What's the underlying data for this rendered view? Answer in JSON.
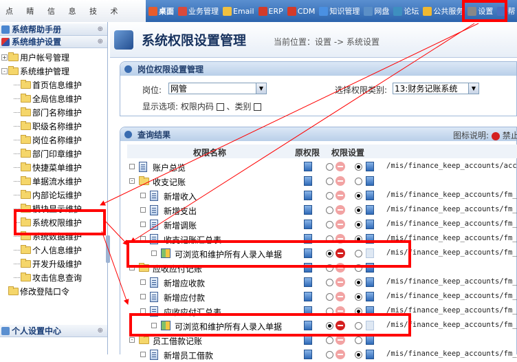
{
  "topbar": {
    "tagline": "点 睛 信 息 技 术",
    "nav": [
      {
        "label": "桌面",
        "icon": "desktop-icon",
        "color": "#e85c2c"
      },
      {
        "label": "业务管理",
        "icon": "users-icon",
        "color": "#d94a3d"
      },
      {
        "label": "Email",
        "icon": "email-icon",
        "color": "#f0c040"
      },
      {
        "label": "ERP",
        "icon": "erp-icon",
        "color": "#d33b2a"
      },
      {
        "label": "CDM",
        "icon": "cdm-icon",
        "color": "#d33b2a"
      },
      {
        "label": "知识管理",
        "icon": "knowledge-icon",
        "color": "#4a90e2"
      },
      {
        "label": "网盘",
        "icon": "netdisk-icon",
        "color": "#5b8fc7"
      },
      {
        "label": "论坛",
        "icon": "forum-icon",
        "color": "#3e8fc0"
      },
      {
        "label": "公共服务",
        "icon": "public-service-icon",
        "color": "#f0b830"
      },
      {
        "label": "设置",
        "icon": "settings-icon",
        "color": "#888888"
      },
      {
        "label": "帮",
        "icon": "help-icon",
        "color": "#4a70c0"
      }
    ]
  },
  "sidebar": {
    "help_title": "系统帮助手册",
    "maint_title": "系统维护设置",
    "personal_title": "个人设置中心",
    "collapse_glyph": "⊕",
    "tree": [
      {
        "label": "用户帐号管理",
        "level": 1,
        "exp": "+"
      },
      {
        "label": "系统维护管理",
        "level": 1,
        "exp": "-"
      },
      {
        "label": "首页信息维护",
        "level": 2
      },
      {
        "label": "全局信息维护",
        "level": 2
      },
      {
        "label": "部门名称维护",
        "level": 2
      },
      {
        "label": "职级名称维护",
        "level": 2
      },
      {
        "label": "岗位名称维护",
        "level": 2
      },
      {
        "label": "部门印章维护",
        "level": 2
      },
      {
        "label": "快捷菜单维护",
        "level": 2
      },
      {
        "label": "单据流水维护",
        "level": 2
      },
      {
        "label": "内部论坛维护",
        "level": 2
      },
      {
        "label": "模块显示维护",
        "level": 2
      },
      {
        "label": "系统权限维护",
        "level": 2
      },
      {
        "label": "系统数据维护",
        "level": 2
      },
      {
        "label": "个人信息维护",
        "level": 2
      },
      {
        "label": "开发升级维护",
        "level": 2
      },
      {
        "label": "攻击信息查询",
        "level": 2
      },
      {
        "label": "修改登陆口令",
        "level": 1
      }
    ]
  },
  "main": {
    "title": "系统权限设置管理",
    "breadcrumb": "当前位置：设置 -> 系统设置"
  },
  "settings_panel": {
    "title": "岗位权限设置管理",
    "post_label": "岗位:",
    "post_value": "网管",
    "category_label": "选择权限类别:",
    "category_value": "13:财务记账系统",
    "display_label": "显示选项: 权限内码",
    "sep": "、类别"
  },
  "results": {
    "title": "查询结果",
    "legend_label": "图标说明:",
    "legend_text": "禁止",
    "col_name": "权限名称",
    "col_orig": "原权限",
    "col_set": "权限设置",
    "rows": [
      {
        "label": "账户总览",
        "indent": 1,
        "kind": "doc",
        "sel": 2,
        "url": "/mis/finance_keep_accounts/accou"
      },
      {
        "label": "收支记账",
        "indent": 1,
        "kind": "folder",
        "sel": 0,
        "url": ""
      },
      {
        "label": "新增收入",
        "indent": 2,
        "kind": "doc",
        "sel": 2,
        "url": "/mis/finance_keep_accounts/fm_ac"
      },
      {
        "label": "新增支出",
        "indent": 2,
        "kind": "doc",
        "sel": 2,
        "url": "/mis/finance_keep_accounts/fm_ac"
      },
      {
        "label": "新增调账",
        "indent": 2,
        "kind": "doc",
        "sel": 2,
        "url": "/mis/finance_keep_accounts/fm_ac"
      },
      {
        "label": "收支记账汇总表",
        "indent": 2,
        "kind": "doc",
        "sel": 2,
        "url": "/mis/finance_keep_accounts/fm_ac"
      },
      {
        "label": "可浏览和维护所有人录入单据",
        "indent": 3,
        "kind": "grid",
        "sel": 1,
        "url": "/mis/finance_keep_accounts/fm_ac"
      },
      {
        "label": "应收应付记账",
        "indent": 1,
        "kind": "folder",
        "sel": 0,
        "url": ""
      },
      {
        "label": "新增应收款",
        "indent": 2,
        "kind": "doc",
        "sel": 2,
        "url": "/mis/finance_keep_accounts/fm_bi"
      },
      {
        "label": "新增应付款",
        "indent": 2,
        "kind": "doc",
        "sel": 2,
        "url": "/mis/finance_keep_accounts/fm_bi"
      },
      {
        "label": "应收应付汇总表",
        "indent": 2,
        "kind": "doc",
        "sel": 2,
        "url": "/mis/finance_keep_accounts/fm_bi"
      },
      {
        "label": "可浏览和维护所有人录入单据",
        "indent": 3,
        "kind": "grid",
        "sel": 1,
        "url": "/mis/finance_keep_accounts/fm_bi"
      },
      {
        "label": "员工借款记账",
        "indent": 1,
        "kind": "folder",
        "sel": 0,
        "url": ""
      },
      {
        "label": "新增员工借款",
        "indent": 2,
        "kind": "doc",
        "sel": 2,
        "url": "/mis/finance_keep_accounts/fm_bi"
      }
    ]
  },
  "annotation": {
    "color": "#ff0000"
  }
}
